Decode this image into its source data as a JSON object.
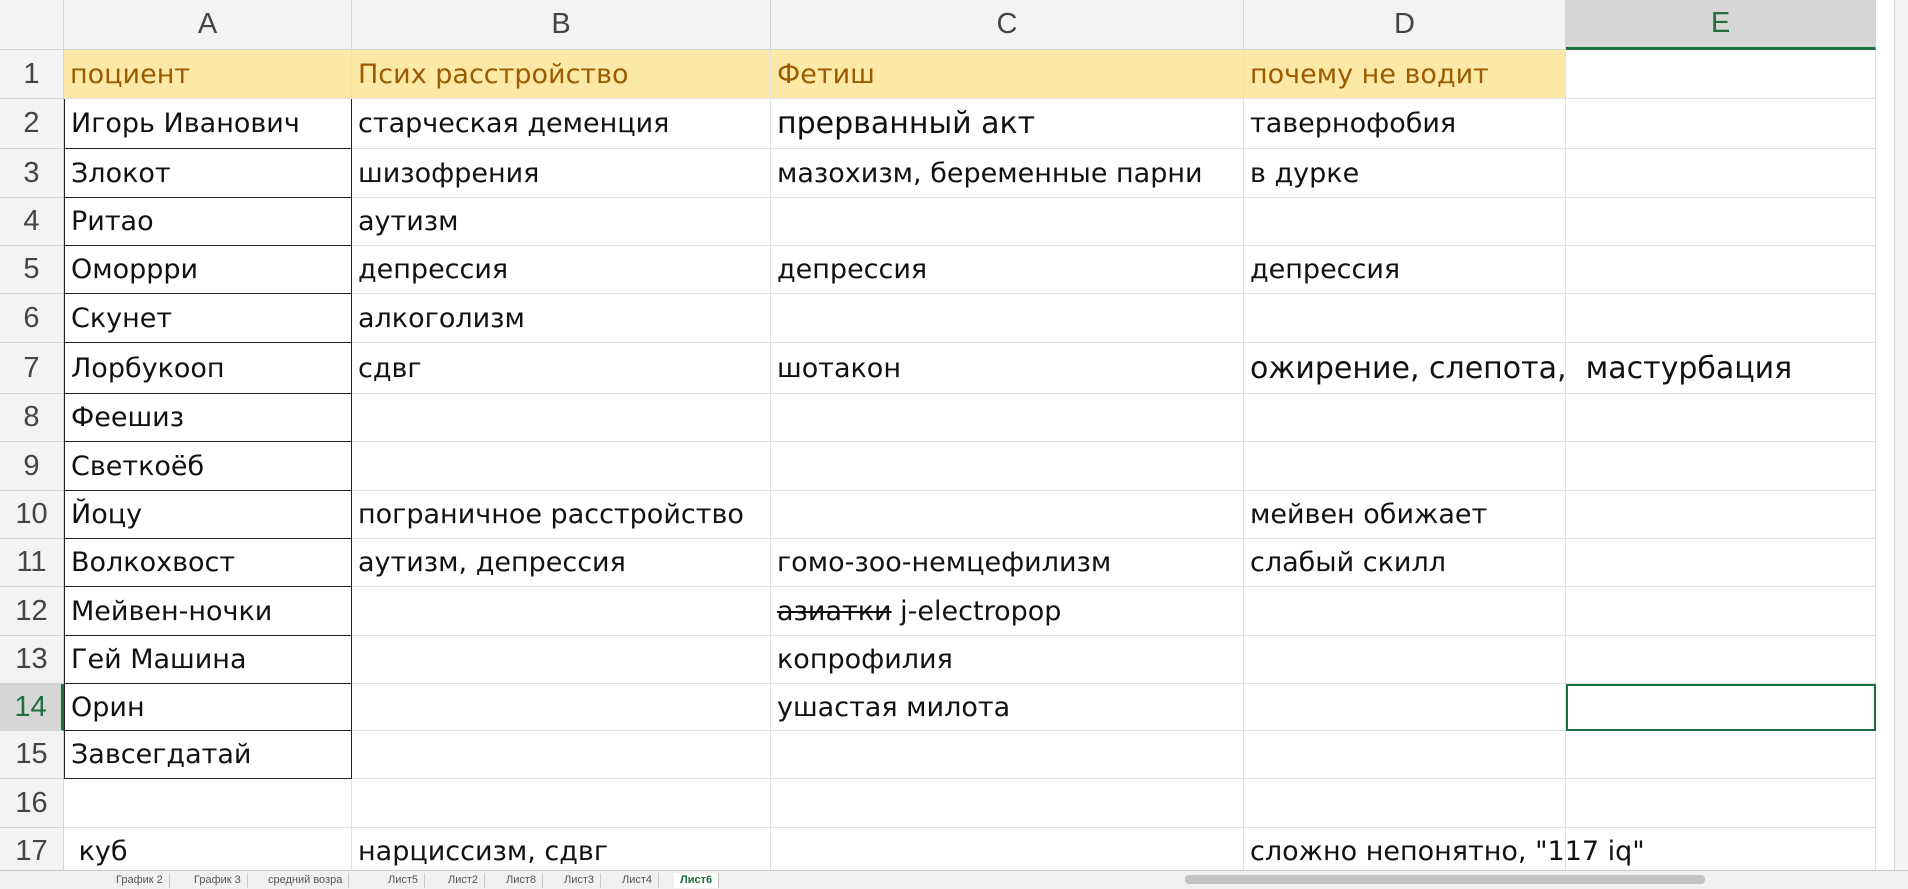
{
  "columns": [
    "A",
    "B",
    "C",
    "D",
    "E"
  ],
  "rows": [
    "1",
    "2",
    "3",
    "4",
    "5",
    "6",
    "7",
    "8",
    "9",
    "10",
    "11",
    "12",
    "13",
    "14",
    "15",
    "16",
    "17"
  ],
  "cells": {
    "A1": "поциент",
    "B1": "Псих расстройство",
    "C1": "Фетиш",
    "D1": "почему не водит",
    "A2": "Игорь Иванович",
    "B2": "старческая деменция",
    "C2": "прерванный акт",
    "D2": "тавернофобия",
    "A3": "Злокот",
    "B3": "шизофрения",
    "C3": "мазохизм, беременные парни",
    "D3": "в дурке",
    "A4": "Ритао",
    "B4": "аутизм",
    "A5": "Оморрри",
    "B5": "депрессия",
    "C5": "депрессия",
    "D5": "депрессия",
    "A6": "Скунет",
    "B6": "алкоголизм",
    "A7": "Лорбукооп",
    "B7": "сдвг",
    "C7": "шотакон",
    "D7": "ожирение, слепота,  мастурбация",
    "A8": "Феешиз",
    "A9": "Светкоёб",
    "A10": "Йоцу",
    "B10": "пограничное расстройство",
    "D10": "мейвен обижает",
    "A11": "Волкохвост",
    "B11": "аутизм, депрессия",
    "C11": "гомо-зоо-немцефилизм",
    "D11": "слабый скилл",
    "A12": "Мейвен-ночки",
    "C12_strike": "азиатки",
    "C12_rest": " j-electropop",
    "A13": "Гей Машина",
    "C13": "копрофилия",
    "A14": "Орин",
    "C14": "ушастая милота",
    "A15": "Завсегдатай",
    "A17": " куб",
    "B17": "нарциссизм, сдвг",
    "D17": "сложно непонятно, \"117 iq\""
  },
  "sheet_tabs": [
    "График 2",
    "График 3",
    "средний возра",
    "Лист5",
    "Лист2",
    "Лист8",
    "Лист3",
    "Лист4",
    "Лист6"
  ],
  "active_tab": "Лист6",
  "active_cell": "E14"
}
